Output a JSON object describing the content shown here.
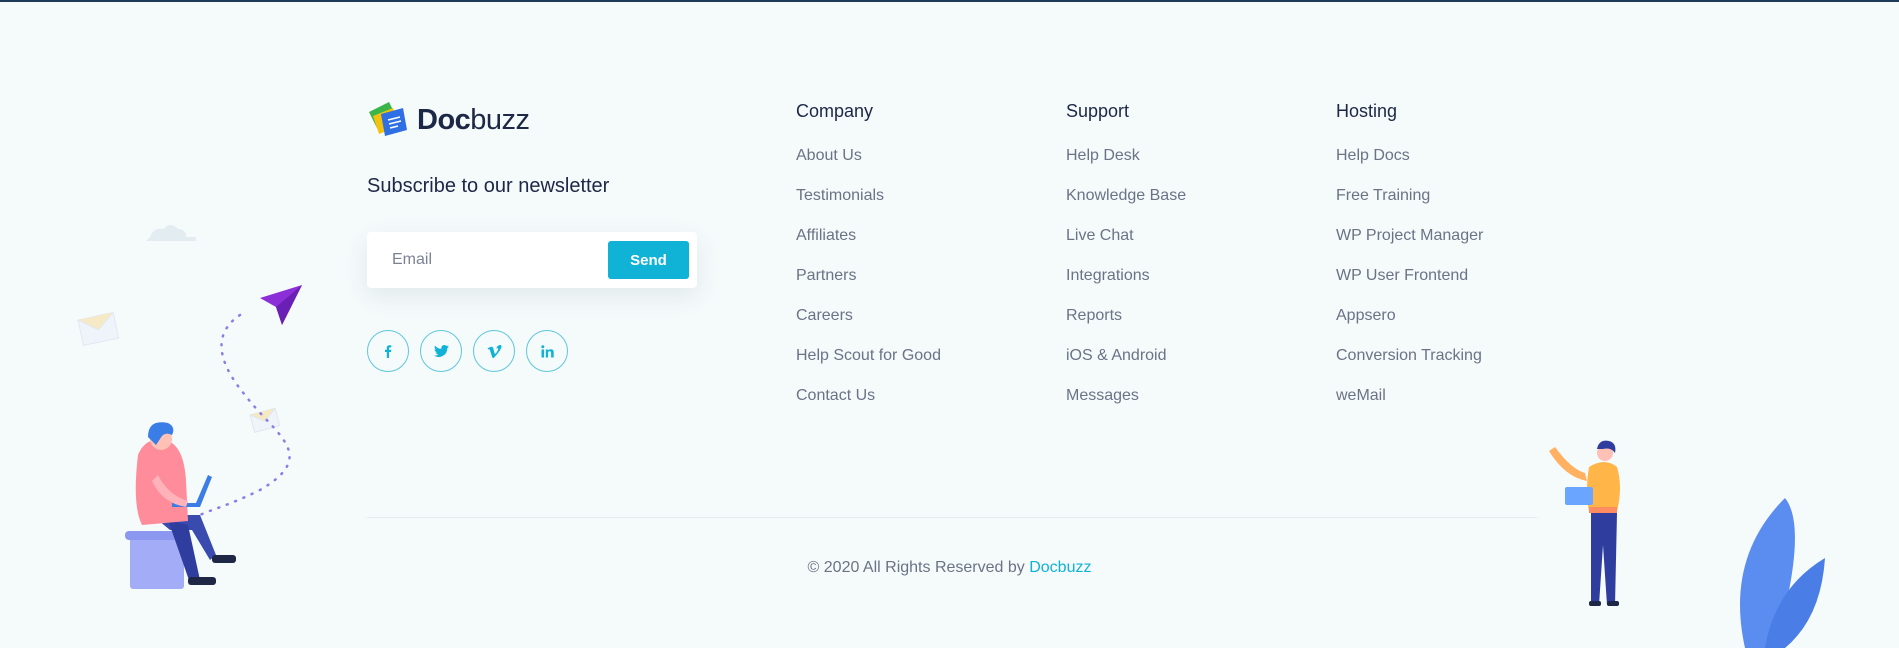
{
  "brand": {
    "name_bold": "Doc",
    "name_light": "buzz"
  },
  "newsletter": {
    "title": "Subscribe to our newsletter",
    "email_placeholder": "Email",
    "send_label": "Send"
  },
  "socials": [
    {
      "icon": "facebook-icon",
      "glyph": "f"
    },
    {
      "icon": "twitter-icon",
      "glyph": "t"
    },
    {
      "icon": "vimeo-icon",
      "glyph": "v"
    },
    {
      "icon": "linkedin-icon",
      "glyph": "in"
    }
  ],
  "columns": [
    {
      "title": "Company",
      "links": [
        "About Us",
        "Testimonials",
        "Affiliates",
        "Partners",
        "Careers",
        "Help Scout for Good",
        "Contact Us"
      ]
    },
    {
      "title": "Support",
      "links": [
        "Help Desk",
        "Knowledge Base",
        "Live Chat",
        "Integrations",
        "Reports",
        "iOS & Android",
        "Messages"
      ]
    },
    {
      "title": "Hosting",
      "links": [
        "Help Docs",
        "Free Training",
        "WP Project Manager",
        "WP User Frontend",
        "Appsero",
        "Conversion Tracking",
        "weMail"
      ]
    }
  ],
  "footer": {
    "copyright_text": "© 2020 All Rights Reserved by",
    "copyright_link": "Docbuzz"
  },
  "colors": {
    "accent": "#10b3d6",
    "heading": "#1d2746",
    "text": "#6b7385",
    "background": "#f5fafb"
  }
}
